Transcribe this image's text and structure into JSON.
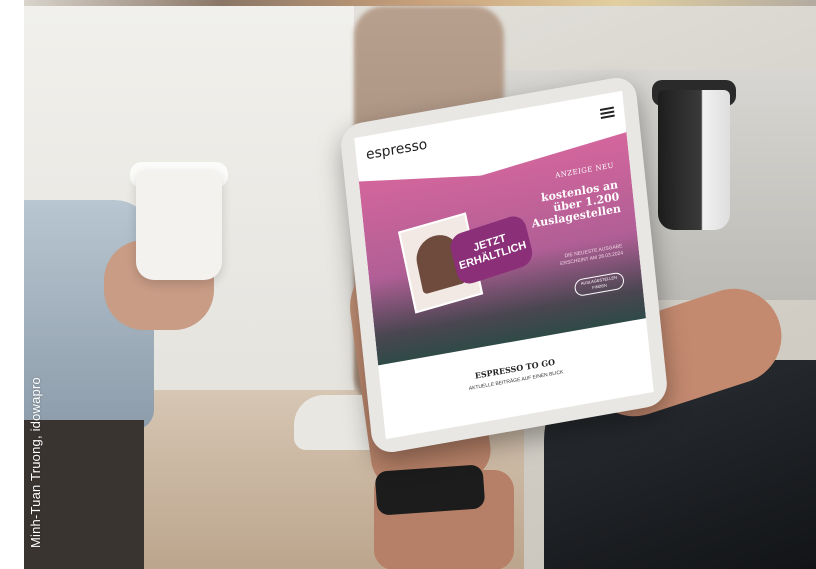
{
  "credit": "Minh-Tuan Truong, idowapro",
  "tablet": {
    "logo": "espresso",
    "hero": {
      "kicker": "ANZEIGE NEU",
      "title": "kostenlos an über 1.200 Auslagestellen",
      "jetzt_line1": "JETZT",
      "jetzt_line2": "ERHÄLTLICH",
      "small_text": "DIE NEUESTE AUSGABE ERSCHEINT AM 28.03.2024",
      "button": "AUSLAGESTELLEN FINDEN"
    },
    "section_title": "ESPRESSO TO GO",
    "section_sub": "AKTUELLE BEITRÄGE AUF EINEN BLICK"
  }
}
